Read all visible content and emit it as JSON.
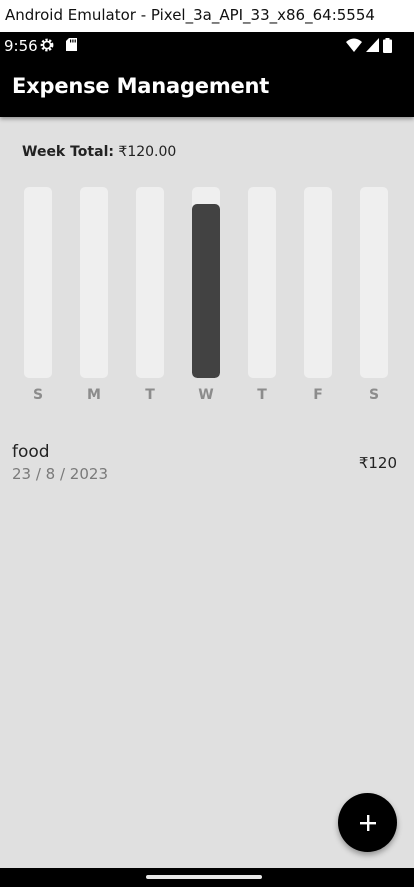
{
  "window": {
    "title": "Android Emulator - Pixel_3a_API_33_x86_64:5554"
  },
  "status_bar": {
    "time": "9:56",
    "icons": [
      "settings-gear-icon",
      "sd-card-icon",
      "wifi-icon",
      "cellular-signal-icon",
      "battery-icon"
    ]
  },
  "app_bar": {
    "title": "Expense Management"
  },
  "week_total": {
    "label": "Week Total:",
    "value": "₹120.00"
  },
  "chart_data": {
    "type": "bar",
    "categories": [
      "S",
      "M",
      "T",
      "W",
      "T",
      "F",
      "S"
    ],
    "values": [
      0,
      0,
      0,
      120,
      0,
      0,
      0
    ],
    "fill_fraction": [
      0,
      0,
      0,
      0.91,
      0,
      0,
      0
    ]
  },
  "transactions": [
    {
      "title": "food",
      "date": "23 / 8 / 2023",
      "amount": "₹120"
    }
  ],
  "fab": {
    "icon": "plus-icon"
  },
  "colors": {
    "app_bar": "#000000",
    "background": "#e0e0e0",
    "bar_fill": "#424242",
    "bar_track": "#efefef"
  }
}
